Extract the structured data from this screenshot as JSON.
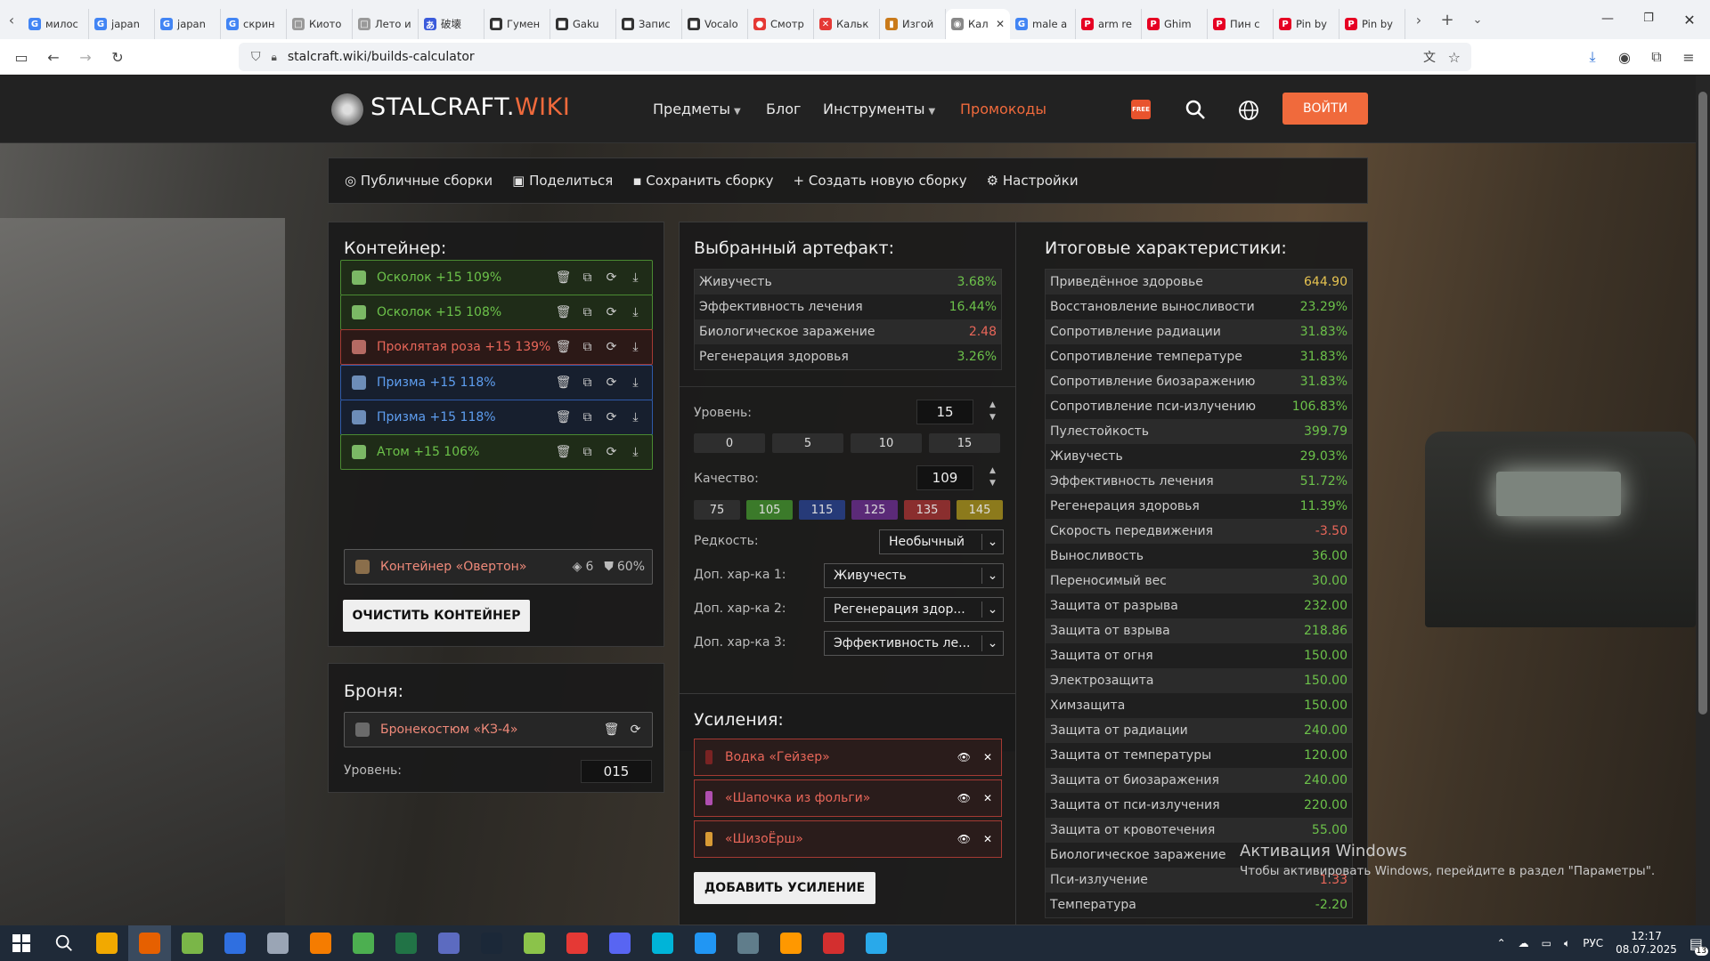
{
  "browser": {
    "tabs": [
      {
        "label": "милос",
        "icon": "G",
        "color": "#4285f4"
      },
      {
        "label": "japan",
        "icon": "G",
        "color": "#4285f4"
      },
      {
        "label": "japan",
        "icon": "G",
        "color": "#4285f4"
      },
      {
        "label": "скрин",
        "icon": "G",
        "color": "#4285f4"
      },
      {
        "label": "Киото",
        "icon": "□",
        "color": "#999"
      },
      {
        "label": "Лето и",
        "icon": "□",
        "color": "#999"
      },
      {
        "label": "破壊",
        "icon": "あ",
        "color": "#3b5bdb"
      },
      {
        "label": "Гумен",
        "icon": "■",
        "color": "#333"
      },
      {
        "label": "Gaku",
        "icon": "■",
        "color": "#333"
      },
      {
        "label": "Запис",
        "icon": "■",
        "color": "#333"
      },
      {
        "label": "Vocalo",
        "icon": "■",
        "color": "#333"
      },
      {
        "label": "Смотр",
        "icon": "●",
        "color": "#e53935"
      },
      {
        "label": "Кальк",
        "icon": "✕",
        "color": "#e53935"
      },
      {
        "label": "Изгой",
        "icon": "▮",
        "color": "#c97a1a"
      },
      {
        "label": "Кал",
        "icon": "◉",
        "color": "#888",
        "active": true
      },
      {
        "label": "male a",
        "icon": "G",
        "color": "#4285f4"
      },
      {
        "label": "arm re",
        "icon": "P",
        "color": "#e60023"
      },
      {
        "label": "Ghim",
        "icon": "P",
        "color": "#e60023"
      },
      {
        "label": "Пин с",
        "icon": "P",
        "color": "#e60023"
      },
      {
        "label": "Pin by",
        "icon": "P",
        "color": "#e60023"
      },
      {
        "label": "Pin by",
        "icon": "P",
        "color": "#e60023"
      }
    ],
    "url": "stalcraft.wiki/builds-calculator"
  },
  "header": {
    "logo_main": "STALCRAFT.",
    "logo_accent": "WIKI",
    "nav": {
      "items": "Предметы",
      "blog": "Блог",
      "tools": "Инструменты",
      "promo": "Промокоды"
    },
    "free_badge": "FREE",
    "login": "ВОЙТИ"
  },
  "toolbar": {
    "public": "Публичные сборки",
    "share": "Поделиться",
    "save": "Сохранить сборку",
    "create": "Создать новую сборку",
    "settings": "Настройки"
  },
  "container": {
    "title": "Контейнер:",
    "slots": [
      {
        "label": "Осколок +15 109%",
        "style": "green"
      },
      {
        "label": "Осколок +15 108%",
        "style": "green"
      },
      {
        "label": "Проклятая роза +15 139%",
        "style": "red"
      },
      {
        "label": "Призма +15 118%",
        "style": "blue"
      },
      {
        "label": "Призма +15 118%",
        "style": "blue"
      },
      {
        "label": "Атом +15 106%",
        "style": "green"
      }
    ],
    "item": {
      "label": "Контейнер «Овертон»",
      "slots": "6",
      "protection": "60%"
    },
    "clear": "ОЧИСТИТЬ КОНТЕЙНЕР"
  },
  "armor": {
    "title": "Броня:",
    "item": "Бронекостюм «КЗ-4»",
    "level_label": "Уровень:",
    "level_value": "015"
  },
  "artifact": {
    "title": "Выбранный артефакт:",
    "stats": [
      {
        "name": "Живучесть",
        "value": "3.68%",
        "color": "g"
      },
      {
        "name": "Эффективность лечения",
        "value": "16.44%",
        "color": "g"
      },
      {
        "name": "Биологическое заражение",
        "value": "2.48",
        "color": "r"
      },
      {
        "name": "Регенерация здоровья",
        "value": "3.26%",
        "color": "g"
      }
    ],
    "level_label": "Уровень:",
    "level_value": "15",
    "level_presets": [
      "0",
      "5",
      "10",
      "15"
    ],
    "quality_label": "Качество:",
    "quality_value": "109",
    "quality_presets": [
      {
        "v": "75",
        "c": "#2e2e2e"
      },
      {
        "v": "105",
        "c": "#3b7a2a"
      },
      {
        "v": "115",
        "c": "#263a78"
      },
      {
        "v": "125",
        "c": "#5b2a78"
      },
      {
        "v": "135",
        "c": "#8a2e2e"
      },
      {
        "v": "145",
        "c": "#8c7a1c"
      }
    ],
    "rarity_label": "Редкость:",
    "rarity_value": "Необычный",
    "extra1_label": "Доп. хар-ка 1:",
    "extra1_value": "Живучесть",
    "extra2_label": "Доп. хар-ка 2:",
    "extra2_value": "Регенерация здор...",
    "extra3_label": "Доп. хар-ка 3:",
    "extra3_value": "Эффективность ле..."
  },
  "boosts": {
    "title": "Усиления:",
    "items": [
      "Водка «Гейзер»",
      "«Шапочка из фольги»",
      "«ШизоЁрш»"
    ],
    "add": "ДОБАВИТЬ УСИЛЕНИЕ"
  },
  "totals": {
    "title": "Итоговые характеристики:",
    "rows": [
      {
        "name": "Приведённое здоровье",
        "value": "644.90",
        "color": "y"
      },
      {
        "name": "Восстановление выносливости",
        "value": "23.29%",
        "color": "g"
      },
      {
        "name": "Сопротивление радиации",
        "value": "31.83%",
        "color": "g"
      },
      {
        "name": "Сопротивление температуре",
        "value": "31.83%",
        "color": "g"
      },
      {
        "name": "Сопротивление биозаражению",
        "value": "31.83%",
        "color": "g"
      },
      {
        "name": "Сопротивление пси-излучению",
        "value": "106.83%",
        "color": "g"
      },
      {
        "name": "Пулестойкость",
        "value": "399.79",
        "color": "g"
      },
      {
        "name": "Живучесть",
        "value": "29.03%",
        "color": "g"
      },
      {
        "name": "Эффективность лечения",
        "value": "51.72%",
        "color": "g"
      },
      {
        "name": "Регенерация здоровья",
        "value": "11.39%",
        "color": "g"
      },
      {
        "name": "Скорость передвижения",
        "value": "-3.50",
        "color": "r"
      },
      {
        "name": "Выносливость",
        "value": "36.00",
        "color": "g"
      },
      {
        "name": "Переносимый вес",
        "value": "30.00",
        "color": "g"
      },
      {
        "name": "Защита от разрыва",
        "value": "232.00",
        "color": "g"
      },
      {
        "name": "Защита от взрыва",
        "value": "218.86",
        "color": "g"
      },
      {
        "name": "Защита от огня",
        "value": "150.00",
        "color": "g"
      },
      {
        "name": "Электрозащита",
        "value": "150.00",
        "color": "g"
      },
      {
        "name": "Химзащита",
        "value": "150.00",
        "color": "g"
      },
      {
        "name": "Защита от радиации",
        "value": "240.00",
        "color": "g"
      },
      {
        "name": "Защита от температуры",
        "value": "120.00",
        "color": "g"
      },
      {
        "name": "Защита от биозаражения",
        "value": "240.00",
        "color": "g"
      },
      {
        "name": "Защита от пси-излучения",
        "value": "220.00",
        "color": "g"
      },
      {
        "name": "Защита от кровотечения",
        "value": "55.00",
        "color": "g"
      },
      {
        "name": "Биологическое заражение",
        "value": "",
        "color": "r"
      },
      {
        "name": "Пси-излучение",
        "value": "1.33",
        "color": "r"
      },
      {
        "name": "Температура",
        "value": "-2.20",
        "color": "g"
      }
    ]
  },
  "watermark": {
    "title": "Активация Windows",
    "subtitle": "Чтобы активировать Windows, перейдите в раздел \"Параметры\"."
  },
  "taskbar": {
    "lang": "РУС",
    "time": "12:17",
    "date": "08.07.2025",
    "notif_count": "13",
    "apps": [
      "#f2a900",
      "#e66000",
      "#7ab648",
      "#2f6fe0",
      "#9aa5b5",
      "#f57c00",
      "#4caf50",
      "#217346",
      "#5c6bc0",
      "#1b2838",
      "#8bc34a",
      "#e53935",
      "#5865f2",
      "#00b4d8",
      "#2196f3",
      "#607d8b",
      "#ff9800",
      "#d32f2f",
      "#29a9ea"
    ]
  }
}
